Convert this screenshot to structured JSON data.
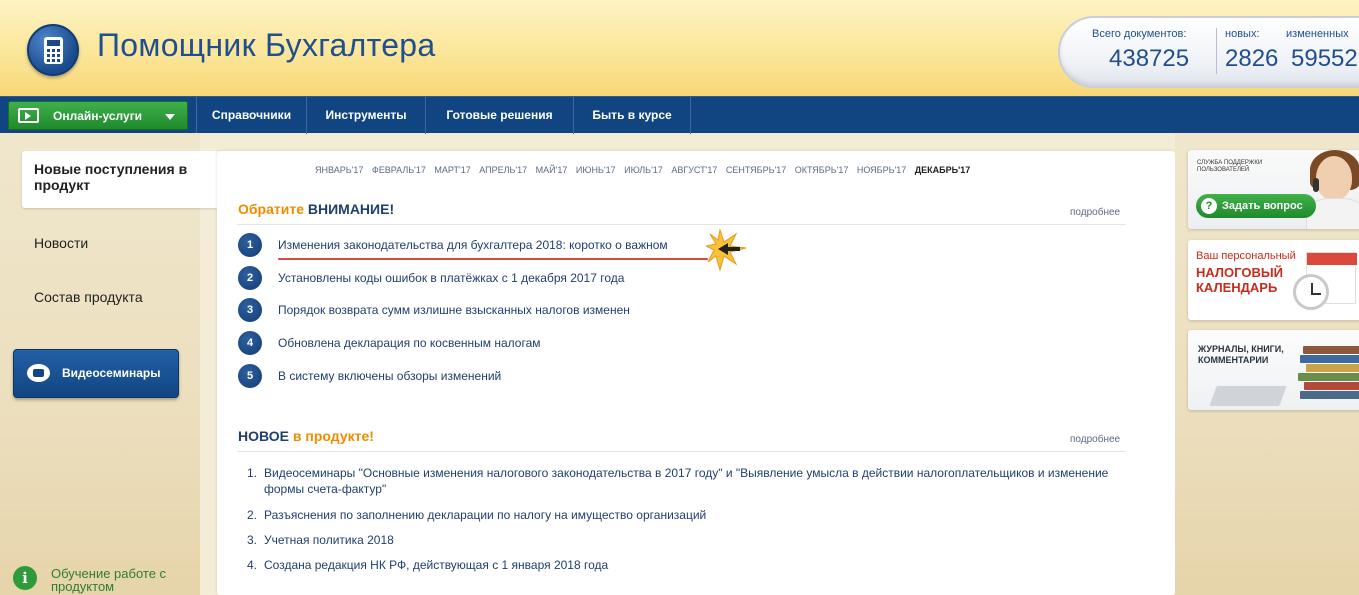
{
  "header": {
    "app_title": "Помощник Бухгалтера",
    "stats": {
      "total_label": "Всего документов:",
      "total_value": "438725",
      "new_label": "новых:",
      "new_value": "2826",
      "changed_label": "измененных",
      "changed_value": "59552"
    }
  },
  "nav": {
    "online_label": "Онлайн-услуги",
    "items": [
      "Справочники",
      "Инструменты",
      "Готовые решения",
      "Быть в курсе"
    ]
  },
  "sidebar": {
    "active_label": "Новые поступления в продукт",
    "links": [
      "Новости",
      "Состав продукта"
    ],
    "video_label": "Видеосеминары",
    "training_label": "Обучение работе с продуктом"
  },
  "main": {
    "months": [
      "ЯНВАРЬ'17",
      "ФЕВРАЛЬ'17",
      "МАРТ'17",
      "АПРЕЛЬ'17",
      "МАЙ'17",
      "ИЮНЬ'17",
      "ИЮЛЬ'17",
      "АВГУСТ'17",
      "СЕНТЯБРЬ'17",
      "ОКТЯБРЬ'17",
      "НОЯБРЬ'17",
      "ДЕКАБРЬ'17"
    ],
    "current_month": "ДЕКАБРЬ'17",
    "attention": {
      "title_part1": "Обратите",
      "title_part2": "ВНИМАНИЕ!",
      "more": "подробнее",
      "items": [
        "Изменения законодательства для бухгалтера 2018: коротко о важном",
        "Установлены коды ошибок в платёжках с 1 декабря 2017 года",
        "Порядок возврата сумм излишне взысканных налогов изменен",
        "Обновлена декларация по косвенным налогам",
        "В систему включены обзоры изменений"
      ]
    },
    "new_section": {
      "title_part1": "НОВОЕ",
      "title_part2": "в продукте!",
      "more": "подробнее",
      "items": [
        "Видеосеминары \"Основные изменения налогового законодательства в 2017 году\" и \"Выявление умысла в действии налогоплательщиков и изменение формы счета-фактур\"",
        "Разъяснения по заполнению декларации по налогу на имущество организаций",
        "Учетная политика 2018",
        "Создана редакция НК РФ, действующая с 1 января 2018 года"
      ]
    }
  },
  "right": {
    "support_label": "СЛУЖБА ПОДДЕРЖКИ ПОЛЬЗОВАТЕЛЕЙ",
    "ask_button": "Задать вопрос",
    "calendar_top": "Ваш персональный",
    "calendar_big": "НАЛОГОВЫЙ КАЛЕНДАРЬ",
    "books_label": "ЖУРНАЛЫ, КНИГИ, КОММЕНТАРИИ"
  },
  "colors": {
    "nav_blue": "#104582",
    "accent_orange": "#f08c00",
    "accent_green": "#2e9a3a",
    "link_blue": "#1f3f6d",
    "highlight_red": "#d84a3c"
  }
}
